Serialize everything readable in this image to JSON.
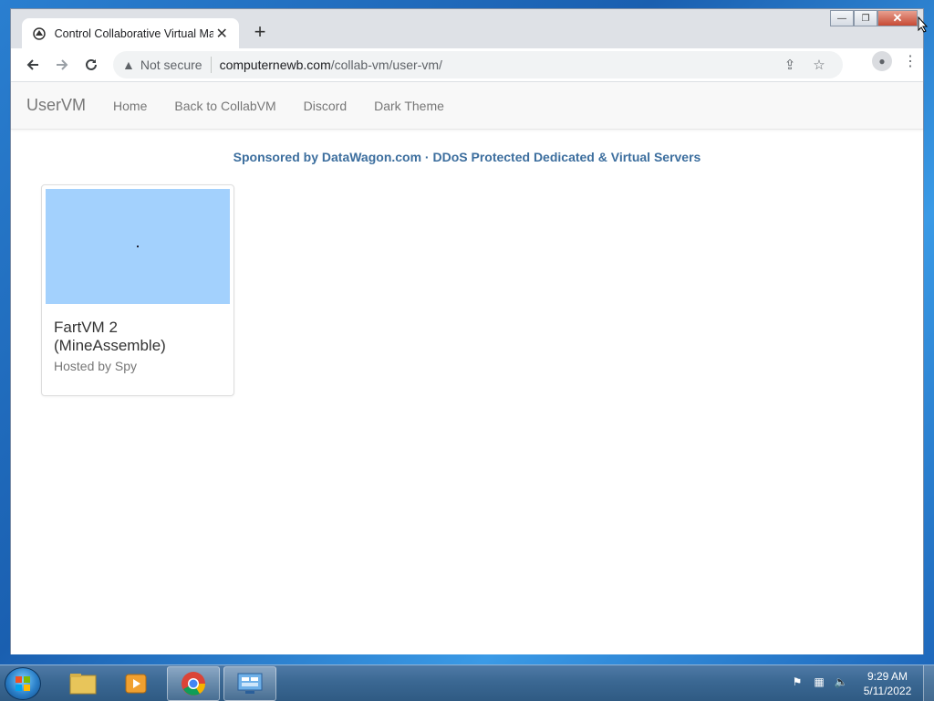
{
  "browser": {
    "tab_title": "Control Collaborative Virtual Ma",
    "tab_close": "✕",
    "new_tab": "+",
    "not_secure": "Not secure",
    "url_host": "computernewb.com",
    "url_path": "/collab-vm/user-vm/",
    "window_controls": {
      "minimize": "—",
      "maximize": "❐",
      "close": "✕"
    }
  },
  "site": {
    "brand": "UserVM",
    "nav": [
      {
        "label": "Home"
      },
      {
        "label": "Back to CollabVM"
      },
      {
        "label": "Discord"
      },
      {
        "label": "Dark Theme"
      }
    ],
    "sponsor": "Sponsored by DataWagon.com · DDoS Protected Dedicated & Virtual Servers"
  },
  "vms": [
    {
      "title": "FartVM 2 (MineAssemble)",
      "host": "Hosted by Spy",
      "thumb_color": "#a3d1fd"
    }
  ],
  "taskbar": {
    "items": [
      "windows-explorer",
      "media-player",
      "chrome",
      "remote-desktop"
    ],
    "clock_time": "9:29 AM",
    "clock_date": "5/11/2022"
  }
}
